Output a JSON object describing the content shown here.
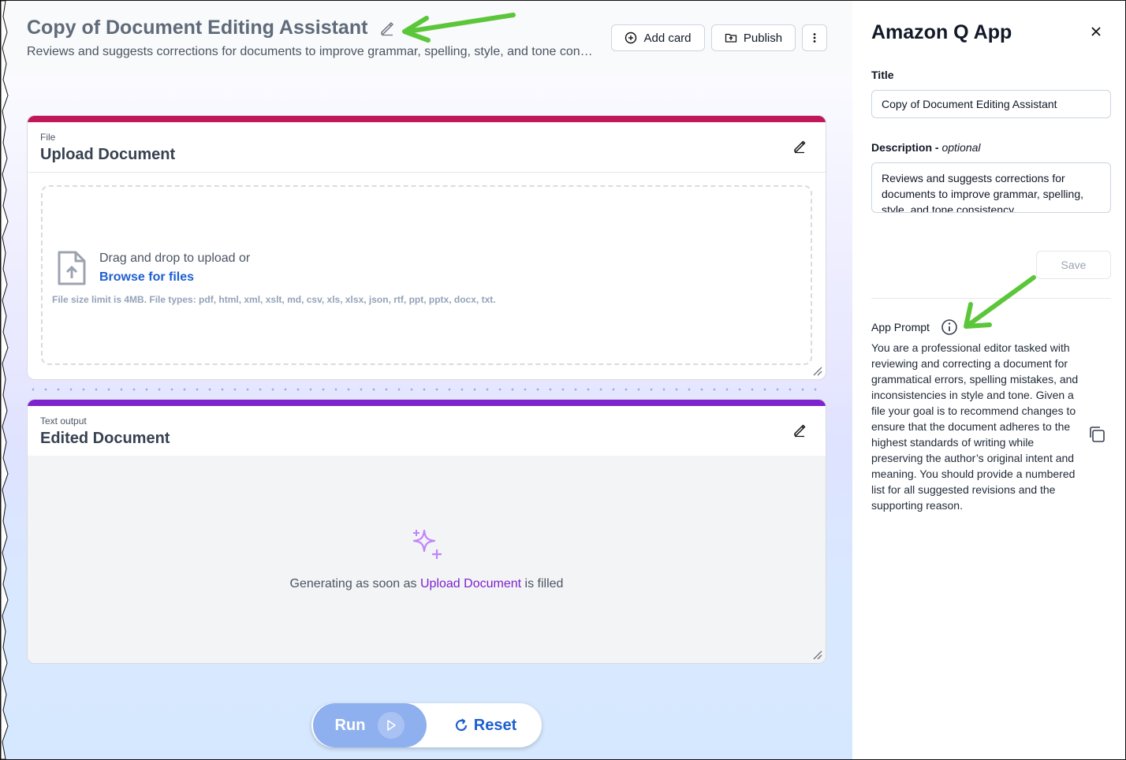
{
  "header": {
    "title": "Copy of Document Editing Assistant",
    "description": "Reviews and suggests corrections for documents to improve grammar, spelling, style, and tone consistency",
    "add_card_label": "Add card",
    "publish_label": "Publish"
  },
  "cards": {
    "upload": {
      "type": "File",
      "title": "Upload Document",
      "drag_text": "Drag and drop to upload or",
      "browse_text": "Browse for files",
      "limit_text": "File size limit is 4MB. File types: pdf, html, xml, xslt, md, csv, xls, xlsx, json, rtf, ppt, pptx, docx, txt.",
      "accent_color": "#c0185a"
    },
    "output": {
      "type": "Text output",
      "title": "Edited Document",
      "gen_prefix": "Generating as soon as",
      "gen_ref": "Upload Document",
      "gen_suffix": "is filled",
      "accent_color": "#7e22ce"
    }
  },
  "actions": {
    "run_label": "Run",
    "reset_label": "Reset"
  },
  "panel": {
    "heading": "Amazon Q App",
    "title_label": "Title",
    "title_value": "Copy of Document Editing Assistant",
    "description_label": "Description",
    "description_optional": "optional",
    "description_value": "Reviews and suggests corrections for documents to improve grammar, spelling, style, and tone consistency",
    "save_label": "Save",
    "prompt_label": "App Prompt",
    "prompt_text": "You are a professional editor tasked with reviewing and correcting a document for grammatical errors, spelling mistakes, and inconsistencies in style and tone. Given a file your goal is to recommend changes to ensure that the document adheres to the highest standards of writing while preserving the author’s original intent and meaning. You should provide a numbered list for all suggested revisions and the supporting reason."
  },
  "colors": {
    "link": "#1d5fd1",
    "annotation_arrow": "#5cc63a"
  }
}
